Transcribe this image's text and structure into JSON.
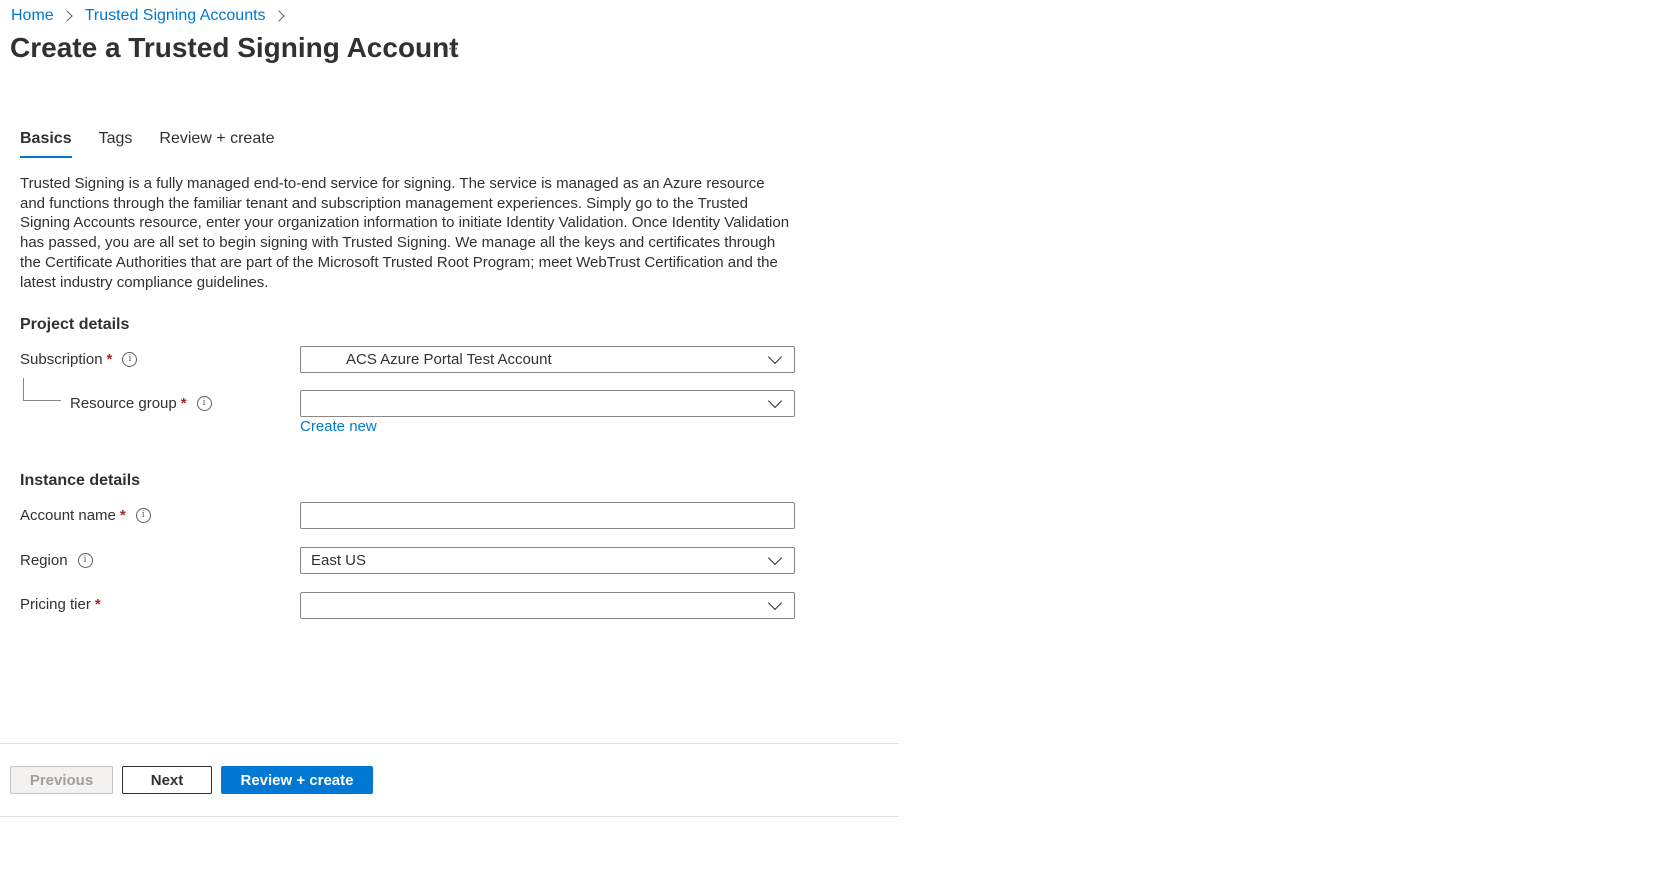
{
  "breadcrumb": {
    "home": "Home",
    "accounts": "Trusted Signing Accounts"
  },
  "page": {
    "title": "Create a Trusted Signing Account",
    "more": "···"
  },
  "tabs": [
    {
      "label": "Basics",
      "active": true
    },
    {
      "label": "Tags",
      "active": false
    },
    {
      "label": "Review + create",
      "active": false
    }
  ],
  "description": "Trusted Signing is a fully managed end-to-end service for signing. The service is managed as an Azure resource and functions through the familiar tenant and subscription management experiences. Simply go to the Trusted Signing Accounts resource, enter your organization information to initiate Identity Validation. Once Identity Validation has passed, you are all set to begin signing with Trusted Signing. We manage all the keys and certificates through the Certificate Authorities that are part of the Microsoft Trusted Root Program; meet WebTrust Certification and the latest industry compliance guidelines.",
  "project_details": {
    "title": "Project details",
    "subscription": {
      "label": "Subscription",
      "required": "*",
      "value": "ACS Azure Portal Test Account"
    },
    "resource_group": {
      "label": "Resource group",
      "required": "*",
      "value": "",
      "create_new": "Create new"
    }
  },
  "instance_details": {
    "title": "Instance details",
    "account_name": {
      "label": "Account name",
      "required": "*",
      "value": ""
    },
    "region": {
      "label": "Region",
      "value": "East US"
    },
    "pricing_tier": {
      "label": "Pricing tier",
      "required": "*",
      "value": ""
    }
  },
  "footer": {
    "previous": "Previous",
    "next": "Next",
    "review_create": "Review + create"
  },
  "colors": {
    "accent": "#0078d4",
    "required": "#a4262c",
    "text": "#323130"
  },
  "icons": [
    "chevron-right-icon",
    "info-icon",
    "chevron-down-icon",
    "more-icon"
  ]
}
